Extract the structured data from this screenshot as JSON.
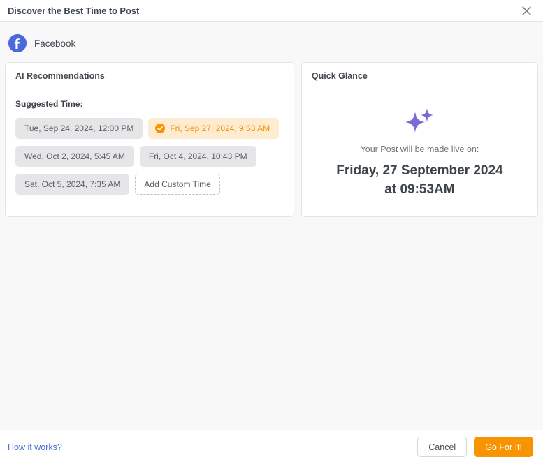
{
  "header": {
    "title": "Discover the Best Time to Post",
    "close_icon": "close-icon"
  },
  "network": {
    "icon": "facebook-icon",
    "name": "Facebook"
  },
  "recommendations_panel": {
    "title": "AI Recommendations",
    "suggested_label": "Suggested Time:",
    "chips": [
      {
        "label": "Tue, Sep 24, 2024, 12:00 PM",
        "selected": false,
        "type": "time"
      },
      {
        "label": "Fri, Sep 27, 2024, 9:53 AM",
        "selected": true,
        "type": "time"
      },
      {
        "label": "Wed, Oct 2, 2024, 5:45 AM",
        "selected": false,
        "type": "time"
      },
      {
        "label": "Fri, Oct 4, 2024, 10:43 PM",
        "selected": false,
        "type": "time"
      },
      {
        "label": "Sat, Oct 5, 2024, 7:35 AM",
        "selected": false,
        "type": "time"
      },
      {
        "label": "Add Custom Time",
        "selected": false,
        "type": "add-custom"
      }
    ],
    "selected_check_icon": "check-circle-icon"
  },
  "quick_glance_panel": {
    "title": "Quick Glance",
    "sparkle_icon": "sparkles-icon",
    "subtitle": "Your Post will be made live on:",
    "scheduled_date": "Friday, 27 September 2024 at 09:53AM"
  },
  "footer": {
    "how_it_works": "How it works?",
    "cancel_label": "Cancel",
    "confirm_label": "Go For It!"
  },
  "colors": {
    "accent_orange": "#f89400",
    "selected_chip_bg": "#fdecd2",
    "link_blue": "#4a6fd4",
    "facebook_blue": "#4b69df",
    "sparkle_purple": "#7b6ad4",
    "page_bg": "#f8f8f9"
  }
}
